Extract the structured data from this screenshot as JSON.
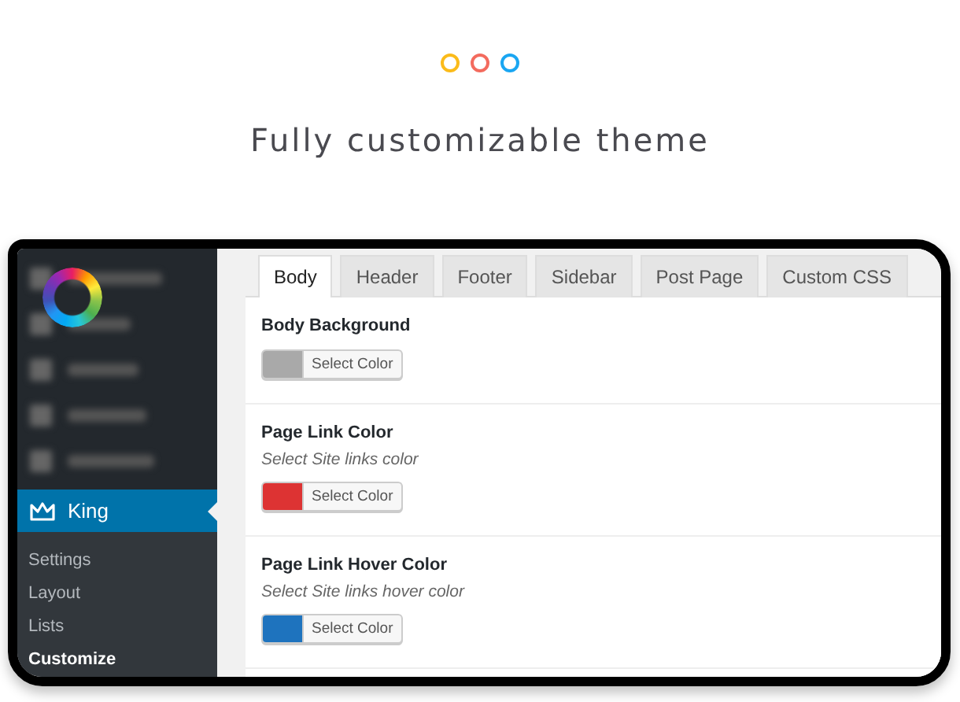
{
  "headline": "Fully customizable theme",
  "sidebar": {
    "section": {
      "label": "King",
      "selected": true
    },
    "items": [
      {
        "label": "Settings",
        "selected": false
      },
      {
        "label": "Layout",
        "selected": false
      },
      {
        "label": "Lists",
        "selected": false
      },
      {
        "label": "Customize",
        "selected": true
      }
    ]
  },
  "tabs": [
    {
      "label": "Body",
      "selected": true
    },
    {
      "label": "Header",
      "selected": false
    },
    {
      "label": "Footer",
      "selected": false
    },
    {
      "label": "Sidebar",
      "selected": false
    },
    {
      "label": "Post Page",
      "selected": false
    },
    {
      "label": "Custom CSS",
      "selected": false
    }
  ],
  "settings": [
    {
      "title": "Body Background",
      "button": "Select Color",
      "color": "#a9a9a9"
    },
    {
      "title": "Page Link Color",
      "description": "Select Site links color",
      "button": "Select Color",
      "color": "#dd3333"
    },
    {
      "title": "Page Link Hover Color",
      "description": "Select Site links hover color",
      "button": "Select Color",
      "color": "#1e73be"
    }
  ]
}
